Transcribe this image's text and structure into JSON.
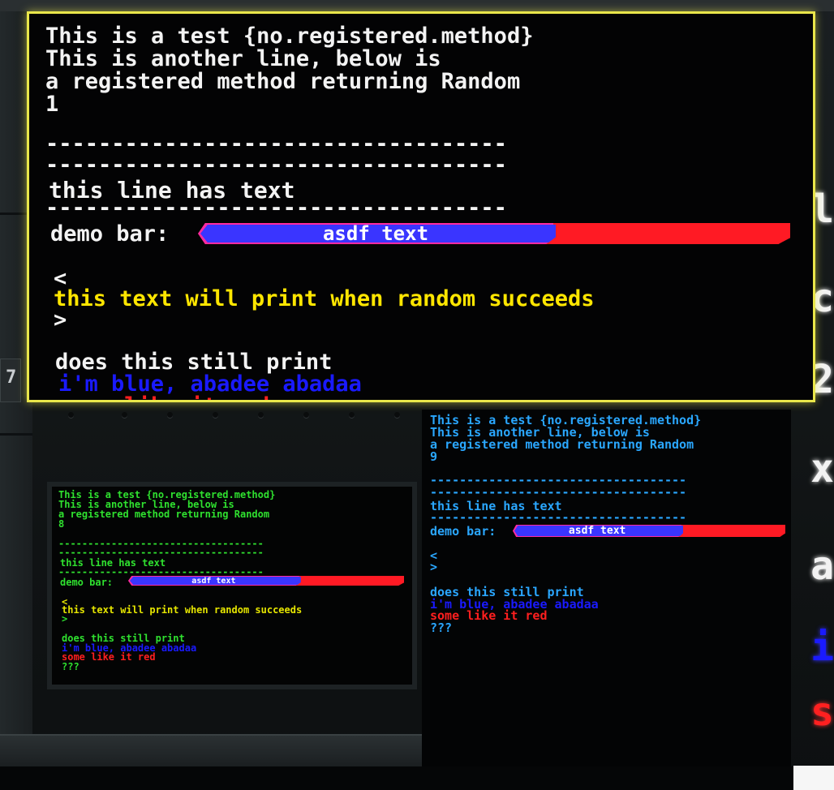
{
  "lines": {
    "test": "This is a test {no.registered.method}",
    "another": "This is another line, below is",
    "registered": "a registered method returning Random",
    "dashes": "-----------------------------------",
    "has_text": "this line has text",
    "demo_bar_label": "demo bar:",
    "bar_text": "asdf text",
    "lt": "<",
    "random_success": "this text will print when random succeeds",
    "gt": ">",
    "still_print": "does this still print",
    "blue": "i'm blue, abadee abadaa",
    "red": "some like it red",
    "qqq": "???"
  },
  "screens": {
    "big": {
      "random_value": "1",
      "text_color": "#f3f3f3",
      "accent_color": "#ffe600",
      "bar_fill": 0.6
    },
    "small": {
      "random_value": "8",
      "text_color": "#2fe12f",
      "accent_color": "#e6e600",
      "bar_fill": 0.62
    },
    "right": {
      "random_value": "9",
      "text_color": "#2aa7ff",
      "bar_fill": 0.62
    }
  },
  "colors": {
    "blue": "#1a1aff",
    "red": "#ff1f1f",
    "bar_fill": "#3a35ff",
    "bar_track": "#ff1a24",
    "frame": "#e9e64a"
  }
}
